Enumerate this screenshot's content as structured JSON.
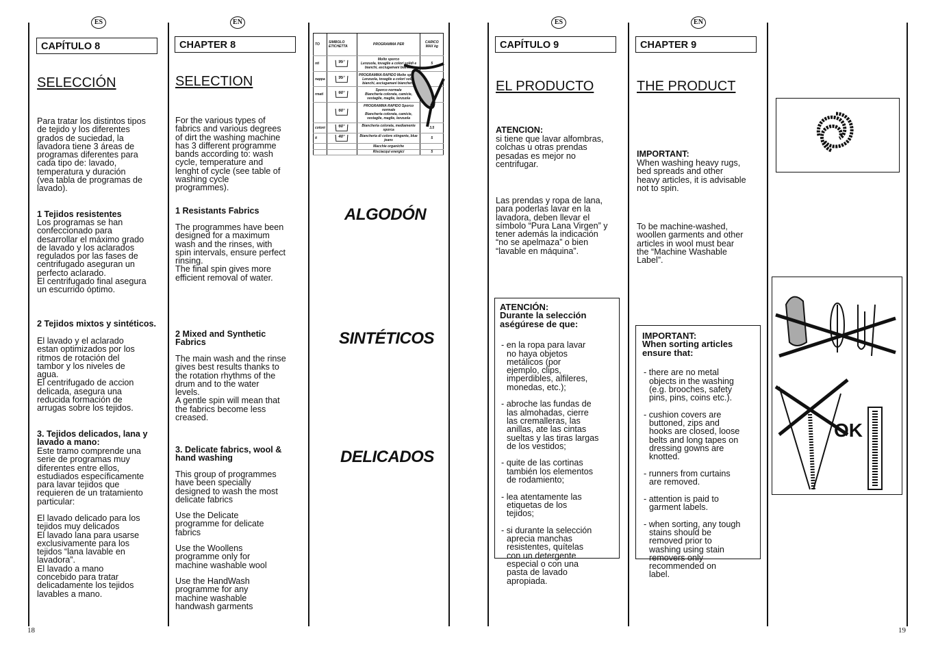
{
  "badges": {
    "es": "ES",
    "en": "EN"
  },
  "page_numbers": {
    "left": "18",
    "right": "19"
  },
  "col1": {
    "chapter": "CAPÍTULO 8",
    "title": "SELECCIÓN",
    "p1": "Para tratar los distintos tipos\nde tejido y los diferentes\ngrados de suciedad, la\nlavadora tiene 3 áreas de\nprogramas diferentes para\ncada tipo de: lavado,\ntemperatura y duración\n(vea tabla de programas de\nlavado).",
    "h1": "1 Tejidos resistentes",
    "p2": "Los programas se han\nconfeccionado para\ndesarrollar el máximo grado\nde lavado y los aclarados\nregulados por las fases de\ncentrifugado aseguran un\nperfecto aclarado.\nEl centrifugado final asegura\nun escurrido óptimo.",
    "h2": "2 Tejidos mixtos y sintéticos.",
    "p3": "El lavado y el aclarado\nestan optimizados por los\nritmos de rotación del\ntambor y los niveles de\nagua.\nEl centrifugado de accion\ndelicada, asegura una\nreducida formación de\narrugas sobre los tejidos.",
    "h3": "3. Tejidos delicados, lana y\nlavado a mano:",
    "p4": "Este tramo comprende una\nserie de programas muy\ndiferentes entre ellos,\nestudiados específicamente\npara lavar tejidos que\nrequieren de un tratamiento\nparticular:",
    "p5": "El lavado delicado para los\ntejidos muy delicados\nEl lavado lana para usarse\nexclusivamente para los\ntejidos “lana lavable en\nlavadora”.\nEl lavado a mano\nconcebido para tratar\ndelicadamente los tejidos\nlavables a mano."
  },
  "col2": {
    "chapter": "CHAPTER 8",
    "title": "SELECTION",
    "p1": "For the various types of\nfabrics and various degrees\nof dirt the washing machine\nhas 3 different programme\nbands according to: wash\ncycle, temperature and\nlenght of cycle (see table of\nwashing cycle\nprogrammes).",
    "h1": "1 Resistants Fabrics",
    "p2": "The programmes have been\ndesigned for a maximum\nwash and the rinses, with\nspin intervals, ensure perfect\nrinsing.\nThe final spin gives more\nefficient removal of water.",
    "h2": "2 Mixed and Synthetic\nFabrics",
    "p3": "The main wash and the rinse\ngives best results thanks to\nthe rotation rhythms of the\ndrum and to the water\nlevels.\nA gentle spin will mean that\nthe fabrics become less\ncreased.",
    "h3": "3. Delicate fabrics, wool &\nhand washing",
    "p4": "This group of programmes\nhave been specially\ndesigned to wash the most\ndelicate fabrics",
    "p5": "Use the Delicate\nprogramme for delicate\nfabrics",
    "p6": "Use the Woollens\nprogramme only for\nmachine washable wool",
    "p7": "Use the HandWash\nprogramme for any\nmachine washable\nhandwash garments"
  },
  "table": {
    "headers": [
      "TO",
      "SIMBOLO ETICHETTA",
      "PROGRAMMA PER",
      "CARICO MAX kg"
    ],
    "rows": [
      {
        "c0": "nti",
        "sym": "95°",
        "prog": "Molto sporco\nLenzuola, tovaglie a colori solidi e bianchi, asciugamani bianchi",
        "load": "5"
      },
      {
        "c0": "nappa",
        "sym": "95°",
        "prog": "PROGRAMMA RAPIDO Molto sporco\nLenzuola, tovaglie a colori solidi bianchi, asciugamani biancheria",
        "load": ""
      },
      {
        "c0": "rmati",
        "sym": "60°",
        "prog": "Sporco normale\nBiancheria colorata, camicie, vestaglie, maglie, lenzuola",
        "load": ""
      },
      {
        "c0": "",
        "sym": "60°",
        "prog": "PROGRAMMA RAPIDO Sporco normale\nBiancheria colorata, camicie, vestaglie, maglie, lenzuola",
        "load": ""
      },
      {
        "c0": "cotoni",
        "sym": "60°",
        "prog": "Biancheria colorata, mediamente sporca",
        "load": "3.5"
      },
      {
        "c0": "ti",
        "sym": "40°",
        "prog": "Biancheria di colore stingente, blue jeans",
        "load": "5"
      },
      {
        "c0": "",
        "sym": "",
        "prog": "Macchie organiche",
        "load": ""
      },
      {
        "c0": "",
        "sym": "",
        "prog": "Risciacqui energici",
        "load": "5"
      }
    ]
  },
  "col3": {
    "band1": "ALGODÓN",
    "band2": "SINTÉTICOS",
    "band3": "DELICADOS"
  },
  "col5": {
    "chapter": "CAPÍTULO 9",
    "title": "EL PRODUCTO",
    "h1": "ATENCION:",
    "p1": "si tiene que lavar alfombras,\ncolchas u otras prendas\npesadas es mejor no\ncentrifugar.",
    "p2": "Las prendas y ropa de lana,\npara poderlas lavar en la\nlavadora, deben llevar el\nsímbolo “Pura Lana Virgen” y\ntener además la indicación\n“no se apelmaza” o bien\n“lavable en máquina”.",
    "box_title": "ATENCIÓN:\nDurante la selección\naségúrese de que:",
    "items": [
      "- en la ropa para lavar\nno haya objetos\nmetálicos (por\nejemplo, clips,\nimperdibles, alfileres,\nmonedas, etc.);",
      "- abroche las fundas de\nlas almohadas, cierre\nlas cremalleras, las\nanillas, ate las cintas\nsueltas y las tiras largas\nde los vestidos;",
      "- quite de las cortinas\ntambién los elementos\nde rodamiento;",
      "- lea atentamente las\netiquetas de los\ntejidos;",
      "- si durante la selección\naprecia manchas\nresistentes, quítelas\ncon un detergente\nespecial o con una\npasta de lavado\napropiada."
    ]
  },
  "col6": {
    "chapter": "CHAPTER 9",
    "title": "THE PRODUCT",
    "h1": "IMPORTANT:",
    "p1": "When washing heavy rugs,\nbed spreads and other\nheavy articles, it is advisable\nnot to spin.",
    "p2": "To be machine-washed,\nwoollen garments and other\narticles in wool must bear\nthe “Machine Washable\nLabel”.",
    "box_title": "IMPORTANT:\nWhen sorting articles\nensure that:",
    "items": [
      "- there are no metal\nobjects in the washing\n(e.g. brooches, safety\npins, pins, coins etc.).",
      "- cushion covers are\nbuttoned, zips and\nhooks are closed, loose\nbelts and long tapes on\ndressing gowns are\nknotted.",
      "- runners from curtains\nare removed.",
      "- attention is paid to\ngarment labels.",
      "- when sorting, any tough\nstains should be\nremoved prior to\nwashing using stain\nremovers only\nrecommended on\nlabel."
    ]
  },
  "illustration": {
    "ok_label": "OK"
  }
}
